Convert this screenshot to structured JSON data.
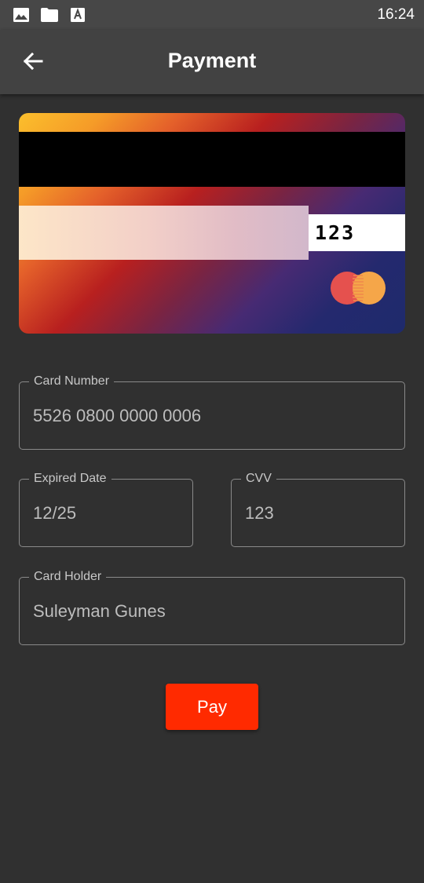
{
  "status_bar": {
    "time": "16:24",
    "icons": [
      "image-icon",
      "folder-icon",
      "font-app-icon"
    ]
  },
  "app_bar": {
    "title": "Payment",
    "back_icon": "arrow-back-icon"
  },
  "card": {
    "cvv": "123",
    "brand_icon": "mastercard-logo-icon",
    "colors": {
      "gradient_start": "#fbbf2c",
      "gradient_mid": "#b8201f",
      "gradient_end": "#1e2a6c"
    }
  },
  "form": {
    "card_number": {
      "label": "Card Number",
      "value": "5526 0800 0000 0006"
    },
    "expired_date": {
      "label": "Expired Date",
      "value": "12/25"
    },
    "cvv": {
      "label": "CVV",
      "value": "123"
    },
    "card_holder": {
      "label": "Card Holder",
      "value": "Suleyman Gunes"
    }
  },
  "pay_button": {
    "label": "Pay",
    "color": "#ff2a00"
  },
  "theme": {
    "background": "#303030",
    "app_bar": "#424242",
    "status_bar": "#474747"
  }
}
